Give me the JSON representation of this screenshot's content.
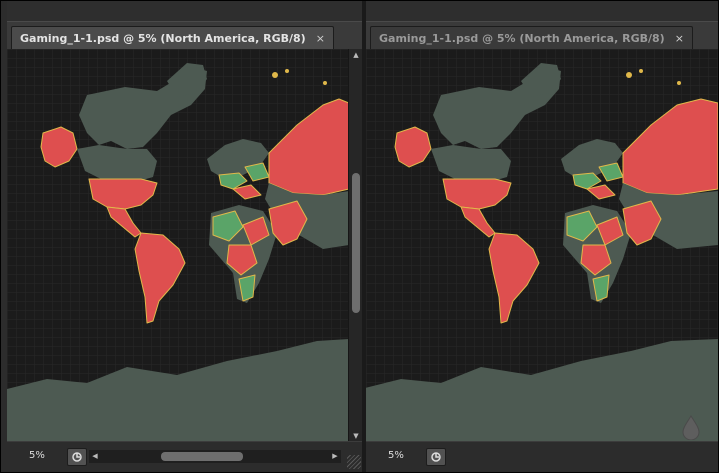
{
  "left_pane": {
    "tab_title": "Gaming_1-1.psd @ 5% (North America, RGB/8)",
    "close_glyph": "×",
    "zoom": "5%"
  },
  "right_pane": {
    "tab_title": "Gaming_1-1.psd @ 5% (North America, RGB/8)",
    "close_glyph": "×",
    "zoom": "5%"
  },
  "icons": {
    "navigator": "navigator-icon",
    "scroll_up": "▲",
    "scroll_down": "▼",
    "scroll_left": "◀",
    "scroll_right": "▶"
  },
  "colors": {
    "canvas_background": "#1b1b1b",
    "grid": "#2a2a2a",
    "land_default": "#4d5a52",
    "land_highlight_red": "#de4f4f",
    "land_highlight_green": "#5aa468",
    "border_yellow": "#e0b84a"
  }
}
